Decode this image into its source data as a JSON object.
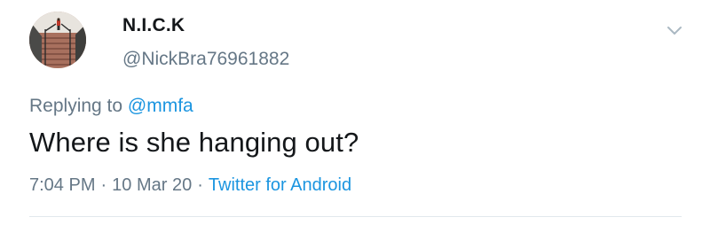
{
  "user": {
    "display_name": "N.I.C.K",
    "handle": "@NickBra76961882",
    "avatar_icon": "profile-photo-stairs"
  },
  "reply": {
    "prefix": "Replying to",
    "mention": "@mmfa"
  },
  "tweet": {
    "text": "Where is she hanging out?"
  },
  "meta": {
    "time": "7:04 PM",
    "separator": "·",
    "date": "10 Mar 20",
    "source": "Twitter for Android"
  },
  "colors": {
    "text": "#14171a",
    "secondary": "#657786",
    "link": "#1b95e0",
    "divider": "#e1e8ed"
  }
}
